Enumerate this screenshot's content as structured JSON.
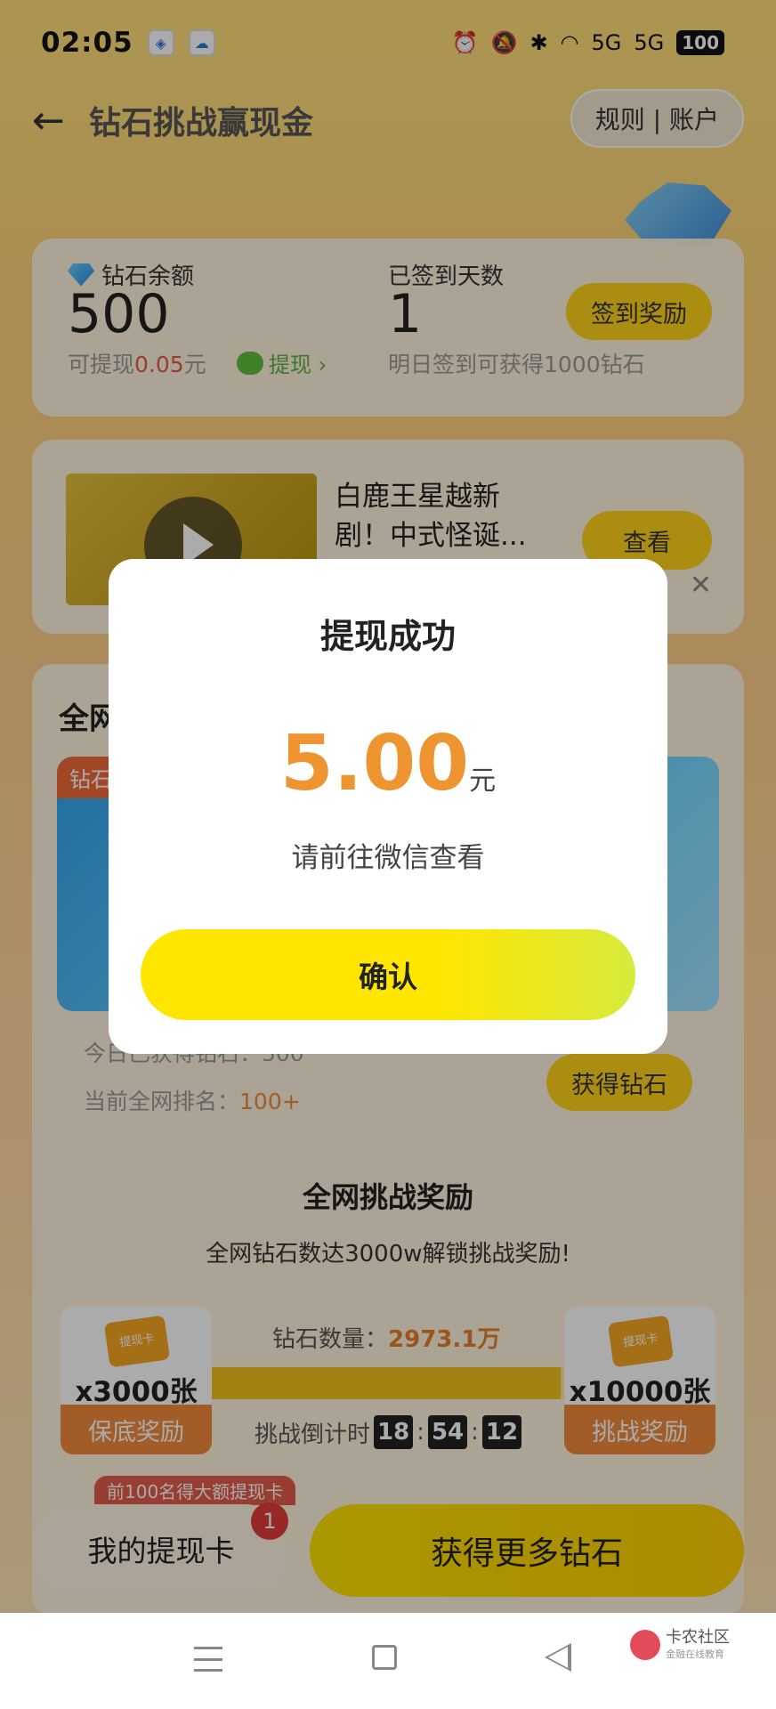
{
  "status_bar": {
    "time": "02:05",
    "battery": "100",
    "signal_1": "5G",
    "signal_2": "5G"
  },
  "header": {
    "title": "钻石挑战赢现金",
    "rules_account": "规则 | 账户"
  },
  "balance": {
    "label": "钻石余额",
    "value": "500",
    "sub_prefix": "可提现",
    "sub_amount": "0.05",
    "sub_unit": "元",
    "withdraw_link": "提现 ›",
    "days_label": "已签到天数",
    "days_value": "1",
    "days_hint": "明日签到可获得1000钻石",
    "checkin_button": "签到奖励"
  },
  "video": {
    "title": "白鹿王星越新剧！中式怪诞...",
    "view_button": "查看",
    "close": "✕"
  },
  "challenge": {
    "title": "全网",
    "banner_tag": "钻石",
    "today_label": "今日已获得钻石：500",
    "rank_prefix": "当前全网排名：",
    "rank_value": "100+",
    "get_gems_button": "获得钻石",
    "reward_title": "全网挑战奖励",
    "reward_sub": "全网钻石数达3000w解锁挑战奖励!",
    "gem_count_label": "钻石数量：",
    "gem_count_value": "2973.1万",
    "progress": 0.99,
    "countdown_label": "挑战倒计时",
    "countdown": [
      "18",
      "54",
      "12"
    ],
    "prize_left": {
      "ticket": "提现卡",
      "count": "x3000张",
      "tag": "保底奖励"
    },
    "prize_right": {
      "ticket": "提现卡",
      "count": "x10000张",
      "tag": "挑战奖励"
    },
    "top100": "前100名得大额提现卡"
  },
  "bottom": {
    "my_cards": "我的提现卡",
    "badge": "1",
    "more_gems": "获得更多钻石"
  },
  "modal": {
    "title": "提现成功",
    "amount": "5.00",
    "unit": "元",
    "hint": "请前往微信查看",
    "confirm": "确认"
  },
  "watermark": {
    "name": "卡农社区",
    "sub": "金融在线教育"
  }
}
